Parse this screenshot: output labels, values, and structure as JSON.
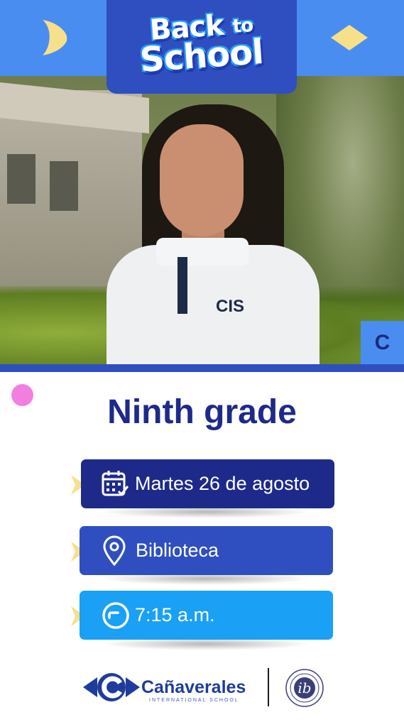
{
  "header": {
    "line1": "Back",
    "line1_small": "to",
    "line2": "School",
    "accent_color": "#4a8df0",
    "tab_color": "#2f4fc0",
    "moon_color": "#f7e08a",
    "diamond_color": "#f7e08a"
  },
  "photo": {
    "shirt_logo": "CIS",
    "badge_letter": "C"
  },
  "title": "Ninth grade",
  "details": [
    {
      "icon": "calendar-icon",
      "text": "Martes 26 de agosto",
      "color": "#1e2a8a"
    },
    {
      "icon": "location-pin-icon",
      "text": "Biblioteca",
      "color": "#2f4fc0"
    },
    {
      "icon": "clock-icon",
      "text": "7:15 a.m.",
      "color": "#1aa0f5"
    }
  ],
  "footer": {
    "brand": "Cañaverales",
    "brand_sub": "INTERNATIONAL SCHOOL",
    "ib_label": "ib"
  }
}
